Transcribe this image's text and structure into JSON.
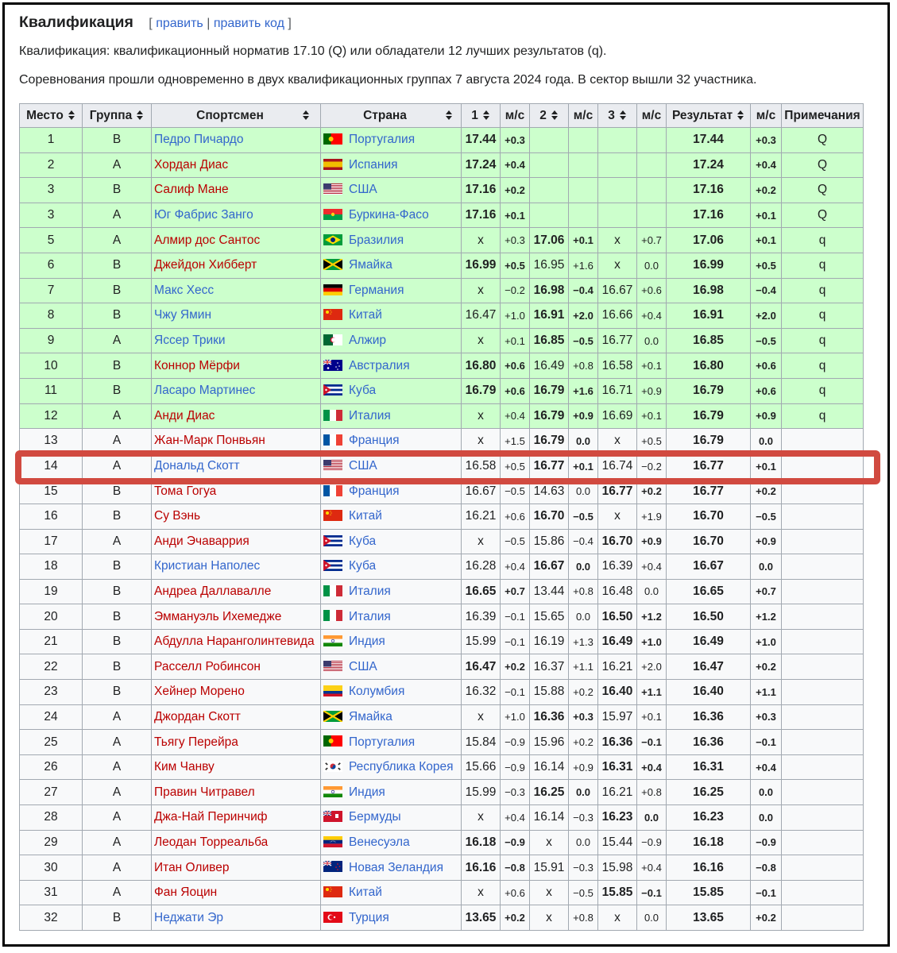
{
  "section": {
    "title": "Квалификация",
    "edit_open": "[",
    "edit": "править",
    "edit_sep": "|",
    "edit_code": "править код",
    "edit_close": "]"
  },
  "intro": [
    "Квалификация: квалификационный норматив 17.10 (Q) или обладатели 12 лучших результатов (q).",
    "Соревнования прошли одновременно в двух квалификационных группах 7 августа 2024 года. В сектор вышли 32 участника."
  ],
  "columns": [
    "Место",
    "Группа",
    "Спортсмен",
    "Страна",
    "1",
    "м/с",
    "2",
    "м/с",
    "3",
    "м/с",
    "Результат",
    "м/с",
    "Примечания"
  ],
  "colors": {
    "qualified_bg": "#ccffcc",
    "plain_bg": "#f8f9fa",
    "header_bg": "#eaecf0",
    "highlight": "#d14a40"
  },
  "highlight_row": 14,
  "rows": [
    {
      "place": "1",
      "group": "B",
      "athlete": "Педро Пичардо",
      "link": "blue",
      "country": "Португалия",
      "flag": "portugal",
      "a1": "17.44",
      "w1": "+0.3",
      "a2": "",
      "w2": "",
      "a3": "",
      "w3": "",
      "res": "17.44",
      "wr": "+0.3",
      "note": "Q",
      "q": true,
      "best": 1
    },
    {
      "place": "2",
      "group": "A",
      "athlete": "Хордан Диас",
      "link": "red",
      "country": "Испания",
      "flag": "spain",
      "a1": "17.24",
      "w1": "+0.4",
      "a2": "",
      "w2": "",
      "a3": "",
      "w3": "",
      "res": "17.24",
      "wr": "+0.4",
      "note": "Q",
      "q": true,
      "best": 1
    },
    {
      "place": "3",
      "group": "B",
      "athlete": "Салиф Мане",
      "link": "red",
      "country": "США",
      "flag": "usa",
      "a1": "17.16",
      "w1": "+0.2",
      "a2": "",
      "w2": "",
      "a3": "",
      "w3": "",
      "res": "17.16",
      "wr": "+0.2",
      "note": "Q",
      "q": true,
      "best": 1
    },
    {
      "place": "3",
      "group": "A",
      "athlete": "Юг Фабрис Занго",
      "link": "blue",
      "country": "Буркина-Фасо",
      "flag": "burkina",
      "a1": "17.16",
      "w1": "+0.1",
      "a2": "",
      "w2": "",
      "a3": "",
      "w3": "",
      "res": "17.16",
      "wr": "+0.1",
      "note": "Q",
      "q": true,
      "best": 1
    },
    {
      "place": "5",
      "group": "A",
      "athlete": "Алмир дос Сантос",
      "link": "red",
      "country": "Бразилия",
      "flag": "brazil",
      "a1": "x",
      "w1": "+0.3",
      "a2": "17.06",
      "w2": "+0.1",
      "a3": "x",
      "w3": "+0.7",
      "res": "17.06",
      "wr": "+0.1",
      "note": "q",
      "q": true,
      "best": 2
    },
    {
      "place": "6",
      "group": "B",
      "athlete": "Джейдон Хибберт",
      "link": "red",
      "country": "Ямайка",
      "flag": "jamaica",
      "a1": "16.99",
      "w1": "+0.5",
      "a2": "16.95",
      "w2": "+1.6",
      "a3": "x",
      "w3": "0.0",
      "res": "16.99",
      "wr": "+0.5",
      "note": "q",
      "q": true,
      "best": 1
    },
    {
      "place": "7",
      "group": "B",
      "athlete": "Макс Хесс",
      "link": "blue",
      "country": "Германия",
      "flag": "germany",
      "a1": "x",
      "w1": "−0.2",
      "a2": "16.98",
      "w2": "−0.4",
      "a3": "16.67",
      "w3": "+0.6",
      "res": "16.98",
      "wr": "−0.4",
      "note": "q",
      "q": true,
      "best": 2
    },
    {
      "place": "8",
      "group": "B",
      "athlete": "Чжу Ямин",
      "link": "blue",
      "country": "Китай",
      "flag": "china",
      "a1": "16.47",
      "w1": "+1.0",
      "a2": "16.91",
      "w2": "+2.0",
      "a3": "16.66",
      "w3": "+0.4",
      "res": "16.91",
      "wr": "+2.0",
      "note": "q",
      "q": true,
      "best": 2
    },
    {
      "place": "9",
      "group": "A",
      "athlete": "Яссер Трики",
      "link": "blue",
      "country": "Алжир",
      "flag": "algeria",
      "a1": "x",
      "w1": "+0.1",
      "a2": "16.85",
      "w2": "−0.5",
      "a3": "16.77",
      "w3": "0.0",
      "res": "16.85",
      "wr": "−0.5",
      "note": "q",
      "q": true,
      "best": 2
    },
    {
      "place": "10",
      "group": "B",
      "athlete": "Коннор Мёрфи",
      "link": "red",
      "country": "Австралия",
      "flag": "australia",
      "a1": "16.80",
      "w1": "+0.6",
      "a2": "16.49",
      "w2": "+0.8",
      "a3": "16.58",
      "w3": "+0.1",
      "res": "16.80",
      "wr": "+0.6",
      "note": "q",
      "q": true,
      "best": 1
    },
    {
      "place": "11",
      "group": "B",
      "athlete": "Ласаро Мартинес",
      "link": "blue",
      "country": "Куба",
      "flag": "cuba",
      "a1": "16.79",
      "w1": "+0.6",
      "a2": "16.79",
      "w2": "+1.6",
      "a3": "16.71",
      "w3": "+0.9",
      "res": "16.79",
      "wr": "+0.6",
      "note": "q",
      "q": true,
      "best": 12
    },
    {
      "place": "12",
      "group": "A",
      "athlete": "Анди Диас",
      "link": "red",
      "country": "Италия",
      "flag": "italy",
      "a1": "x",
      "w1": "+0.4",
      "a2": "16.79",
      "w2": "+0.9",
      "a3": "16.69",
      "w3": "+0.1",
      "res": "16.79",
      "wr": "+0.9",
      "note": "q",
      "q": true,
      "best": 2
    },
    {
      "place": "13",
      "group": "A",
      "athlete": "Жан-Марк Понвьян",
      "link": "red",
      "country": "Франция",
      "flag": "france",
      "a1": "x",
      "w1": "+1.5",
      "a2": "16.79",
      "w2": "0.0",
      "a3": "x",
      "w3": "+0.5",
      "res": "16.79",
      "wr": "0.0",
      "note": "",
      "q": false,
      "best": 2
    },
    {
      "place": "14",
      "group": "A",
      "athlete": "Дональд Скотт",
      "link": "blue",
      "country": "США",
      "flag": "usa",
      "a1": "16.58",
      "w1": "+0.5",
      "a2": "16.77",
      "w2": "+0.1",
      "a3": "16.74",
      "w3": "−0.2",
      "res": "16.77",
      "wr": "+0.1",
      "note": "",
      "q": false,
      "best": 2
    },
    {
      "place": "15",
      "group": "B",
      "athlete": "Тома Гогуа",
      "link": "red",
      "country": "Франция",
      "flag": "france",
      "a1": "16.67",
      "w1": "−0.5",
      "a2": "14.63",
      "w2": "0.0",
      "a3": "16.77",
      "w3": "+0.2",
      "res": "16.77",
      "wr": "+0.2",
      "note": "",
      "q": false,
      "best": 3
    },
    {
      "place": "16",
      "group": "B",
      "athlete": "Су Вэнь",
      "link": "red",
      "country": "Китай",
      "flag": "china",
      "a1": "16.21",
      "w1": "+0.6",
      "a2": "16.70",
      "w2": "−0.5",
      "a3": "x",
      "w3": "+1.9",
      "res": "16.70",
      "wr": "−0.5",
      "note": "",
      "q": false,
      "best": 2
    },
    {
      "place": "17",
      "group": "A",
      "athlete": "Анди Эчаваррия",
      "link": "red",
      "country": "Куба",
      "flag": "cuba",
      "a1": "x",
      "w1": "−0.5",
      "a2": "15.86",
      "w2": "−0.4",
      "a3": "16.70",
      "w3": "+0.9",
      "res": "16.70",
      "wr": "+0.9",
      "note": "",
      "q": false,
      "best": 3
    },
    {
      "place": "18",
      "group": "B",
      "athlete": "Кристиан Наполес",
      "link": "blue",
      "country": "Куба",
      "flag": "cuba",
      "a1": "16.28",
      "w1": "+0.4",
      "a2": "16.67",
      "w2": "0.0",
      "a3": "16.39",
      "w3": "+0.4",
      "res": "16.67",
      "wr": "0.0",
      "note": "",
      "q": false,
      "best": 2
    },
    {
      "place": "19",
      "group": "B",
      "athlete": "Андреа Даллавалле",
      "link": "red",
      "country": "Италия",
      "flag": "italy",
      "a1": "16.65",
      "w1": "+0.7",
      "a2": "13.44",
      "w2": "+0.8",
      "a3": "16.48",
      "w3": "0.0",
      "res": "16.65",
      "wr": "+0.7",
      "note": "",
      "q": false,
      "best": 1
    },
    {
      "place": "20",
      "group": "B",
      "athlete": "Эммануэль Ихемедже",
      "link": "red",
      "country": "Италия",
      "flag": "italy",
      "a1": "16.39",
      "w1": "−0.1",
      "a2": "15.65",
      "w2": "0.0",
      "a3": "16.50",
      "w3": "+1.2",
      "res": "16.50",
      "wr": "+1.2",
      "note": "",
      "q": false,
      "best": 3
    },
    {
      "place": "21",
      "group": "B",
      "athlete": "Абдулла Наранголинтевида",
      "link": "red",
      "country": "Индия",
      "flag": "india",
      "a1": "15.99",
      "w1": "−0.1",
      "a2": "16.19",
      "w2": "+1.3",
      "a3": "16.49",
      "w3": "+1.0",
      "res": "16.49",
      "wr": "+1.0",
      "note": "",
      "q": false,
      "best": 3
    },
    {
      "place": "22",
      "group": "B",
      "athlete": "Расселл Робинсон",
      "link": "red",
      "country": "США",
      "flag": "usa",
      "a1": "16.47",
      "w1": "+0.2",
      "a2": "16.37",
      "w2": "+1.1",
      "a3": "16.21",
      "w3": "+2.0",
      "res": "16.47",
      "wr": "+0.2",
      "note": "",
      "q": false,
      "best": 1
    },
    {
      "place": "23",
      "group": "B",
      "athlete": "Хейнер Морено",
      "link": "red",
      "country": "Колумбия",
      "flag": "colombia",
      "a1": "16.32",
      "w1": "−0.1",
      "a2": "15.88",
      "w2": "+0.2",
      "a3": "16.40",
      "w3": "+1.1",
      "res": "16.40",
      "wr": "+1.1",
      "note": "",
      "q": false,
      "best": 3
    },
    {
      "place": "24",
      "group": "A",
      "athlete": "Джордан Скотт",
      "link": "red",
      "country": "Ямайка",
      "flag": "jamaica",
      "a1": "x",
      "w1": "+1.0",
      "a2": "16.36",
      "w2": "+0.3",
      "a3": "15.97",
      "w3": "+0.1",
      "res": "16.36",
      "wr": "+0.3",
      "note": "",
      "q": false,
      "best": 2
    },
    {
      "place": "25",
      "group": "A",
      "athlete": "Тьягу Перейра",
      "link": "red",
      "country": "Португалия",
      "flag": "portugal",
      "a1": "15.84",
      "w1": "−0.9",
      "a2": "15.96",
      "w2": "+0.2",
      "a3": "16.36",
      "w3": "−0.1",
      "res": "16.36",
      "wr": "−0.1",
      "note": "",
      "q": false,
      "best": 3
    },
    {
      "place": "26",
      "group": "A",
      "athlete": "Ким Чанву",
      "link": "red",
      "country": "Республика Корея",
      "flag": "korea",
      "a1": "15.66",
      "w1": "−0.9",
      "a2": "16.14",
      "w2": "+0.9",
      "a3": "16.31",
      "w3": "+0.4",
      "res": "16.31",
      "wr": "+0.4",
      "note": "",
      "q": false,
      "best": 3
    },
    {
      "place": "27",
      "group": "A",
      "athlete": "Правин Читравел",
      "link": "red",
      "country": "Индия",
      "flag": "india",
      "a1": "15.99",
      "w1": "−0.3",
      "a2": "16.25",
      "w2": "0.0",
      "a3": "16.21",
      "w3": "+0.8",
      "res": "16.25",
      "wr": "0.0",
      "note": "",
      "q": false,
      "best": 2
    },
    {
      "place": "28",
      "group": "A",
      "athlete": "Джа-Най Перинчиф",
      "link": "red",
      "country": "Бермуды",
      "flag": "bermuda",
      "a1": "x",
      "w1": "+0.4",
      "a2": "16.14",
      "w2": "−0.3",
      "a3": "16.23",
      "w3": "0.0",
      "res": "16.23",
      "wr": "0.0",
      "note": "",
      "q": false,
      "best": 3
    },
    {
      "place": "29",
      "group": "A",
      "athlete": "Леодан Торреальба",
      "link": "red",
      "country": "Венесуэла",
      "flag": "venezuela",
      "a1": "16.18",
      "w1": "−0.9",
      "a2": "x",
      "w2": "0.0",
      "a3": "15.44",
      "w3": "−0.9",
      "res": "16.18",
      "wr": "−0.9",
      "note": "",
      "q": false,
      "best": 1
    },
    {
      "place": "30",
      "group": "A",
      "athlete": "Итан Оливер",
      "link": "red",
      "country": "Новая Зеландия",
      "flag": "nz",
      "a1": "16.16",
      "w1": "−0.8",
      "a2": "15.91",
      "w2": "−0.3",
      "a3": "15.98",
      "w3": "+0.4",
      "res": "16.16",
      "wr": "−0.8",
      "note": "",
      "q": false,
      "best": 1
    },
    {
      "place": "31",
      "group": "A",
      "athlete": "Фан Яоцин",
      "link": "red",
      "country": "Китай",
      "flag": "china",
      "a1": "x",
      "w1": "+0.6",
      "a2": "x",
      "w2": "−0.5",
      "a3": "15.85",
      "w3": "−0.1",
      "res": "15.85",
      "wr": "−0.1",
      "note": "",
      "q": false,
      "best": 3
    },
    {
      "place": "32",
      "group": "B",
      "athlete": "Неджати Эр",
      "link": "blue",
      "country": "Турция",
      "flag": "turkey",
      "a1": "13.65",
      "w1": "+0.2",
      "a2": "x",
      "w2": "+0.8",
      "a3": "x",
      "w3": "0.0",
      "res": "13.65",
      "wr": "+0.2",
      "note": "",
      "q": false,
      "best": 1
    }
  ]
}
